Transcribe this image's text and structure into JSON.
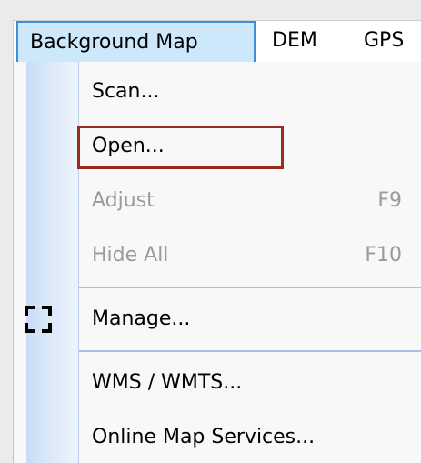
{
  "menubar": {
    "items": [
      {
        "label": "Background Map"
      },
      {
        "label": "DEM"
      },
      {
        "label": "GPS"
      }
    ]
  },
  "dropdown": {
    "items": [
      {
        "label": "Scan...",
        "enabled": true
      },
      {
        "label": "Open...",
        "enabled": true,
        "highlighted": true
      },
      {
        "label": "Adjust",
        "shortcut": "F9",
        "enabled": false
      },
      {
        "label": "Hide All",
        "shortcut": "F10",
        "enabled": false
      },
      {
        "label": "Manage...",
        "enabled": true,
        "icon": "manage-frame-icon"
      },
      {
        "label": "WMS / WMTS...",
        "enabled": true
      },
      {
        "label": "Online Map Services...",
        "enabled": true
      }
    ]
  },
  "colors": {
    "highlight_box": "#9b2b21",
    "active_menu_bg": "#cde8fb",
    "active_menu_border": "#3d8ed6",
    "disabled_text": "#9a9a9a"
  }
}
